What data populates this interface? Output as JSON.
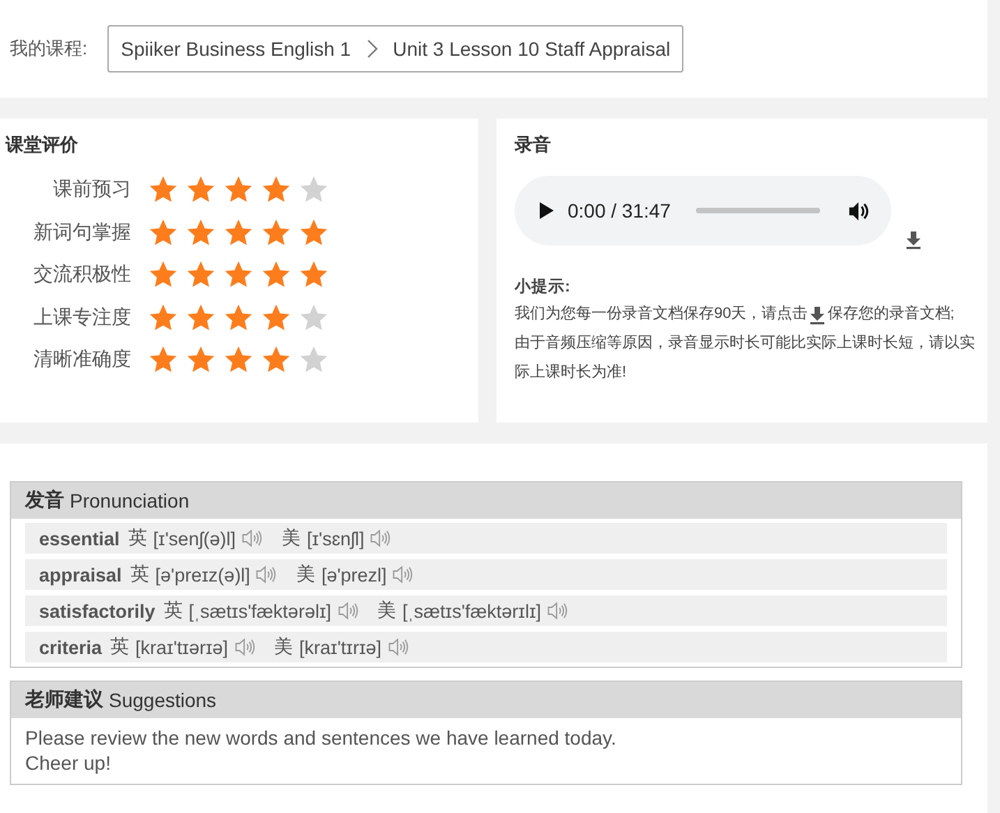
{
  "course": {
    "label": "我的课程:",
    "breadcrumb": [
      "Spiiker Business English 1",
      "Unit 3 Lesson 10 Staff Appraisal"
    ]
  },
  "evaluation": {
    "title": "课堂评价",
    "items": [
      {
        "label": "课前预习",
        "stars": 4
      },
      {
        "label": "新词句掌握",
        "stars": 5
      },
      {
        "label": "交流积极性",
        "stars": 5
      },
      {
        "label": "上课专注度",
        "stars": 4
      },
      {
        "label": "清晰准确度",
        "stars": 4
      }
    ]
  },
  "recording": {
    "title": "录音",
    "player": {
      "time": "0:00 / 31:47",
      "level": 0
    },
    "tip": {
      "label": "小提示:",
      "line1_before": "我们为您每一份录音文档保存90天，请点击",
      "line1_after": "保存您的录音文档;",
      "line2": "由于音频压缩等原因，录音显示时长可能比实际上课时长短，请以实际上课时长为准!"
    }
  },
  "pronunciation": {
    "title_cn": "发音",
    "title_en": "Pronunciation",
    "words": [
      {
        "word": "essential",
        "uk_label": "英",
        "uk": "[ɪ'senʃ(ə)l]",
        "us_label": "美",
        "us": "[ɪ'sɛnʃl]"
      },
      {
        "word": "appraisal",
        "uk_label": "英",
        "uk": "[ə'preɪz(ə)l]",
        "us_label": "美",
        "us": "[ə'prezl]"
      },
      {
        "word": "satisfactorily",
        "uk_label": "英",
        "uk": "[ˌsætɪs'fæktərəlɪ]",
        "us_label": "美",
        "us": "[ˌsætɪs'fæktərɪlɪ]"
      },
      {
        "word": "criteria",
        "uk_label": "英",
        "uk": "[kraɪ'tɪərɪə]",
        "us_label": "美",
        "us": "[kraɪ'tɪrɪə]"
      }
    ]
  },
  "suggestions": {
    "title_cn": "老师建议",
    "title_en": "Suggestions",
    "lines": [
      "Please review the new words and sentences we have learned today.",
      "Cheer up!"
    ]
  }
}
